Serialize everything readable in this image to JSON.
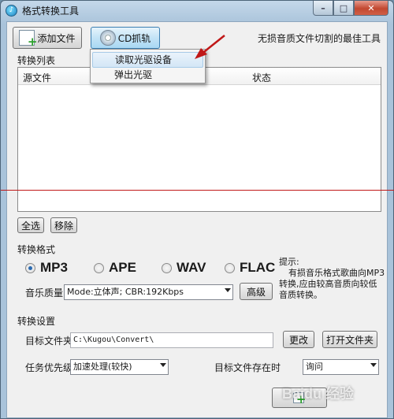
{
  "window": {
    "title": "格式转换工具"
  },
  "toolbar": {
    "add_file": "添加文件",
    "cd_rip": "CD抓轨",
    "slogan": "无损音质文件切割的最佳工具"
  },
  "cd_menu": {
    "items": [
      "读取光驱设备",
      "弹出光驱"
    ]
  },
  "list": {
    "label": "转换列表",
    "columns": [
      "源文件",
      "状态"
    ]
  },
  "list_actions": {
    "select_all": "全选",
    "remove": "移除"
  },
  "format": {
    "label": "转换格式",
    "options": [
      "MP3",
      "APE",
      "WAV",
      "FLAC"
    ],
    "selected": "MP3",
    "quality_label": "音乐质量",
    "quality_value": "Mode:立体声; CBR:192Kbps",
    "advanced": "高级",
    "hint_title": "提示:",
    "hint_body": "有损音乐格式歌曲向MP3转换,应由较高音质向较低音质转换。"
  },
  "settings": {
    "label": "转换设置",
    "target_folder_label": "目标文件夹",
    "target_folder_value": "C:\\Kugou\\Convert\\",
    "change": "更改",
    "open_folder": "打开文件夹",
    "priority_label": "任务优先级",
    "priority_value": "加速处理(较快)",
    "exists_label": "目标文件存在时",
    "exists_value": "询问"
  },
  "watermark": "Baidu 经验",
  "colors": {
    "accent_red": "#c01818",
    "title_bar": "#a9c3da"
  }
}
